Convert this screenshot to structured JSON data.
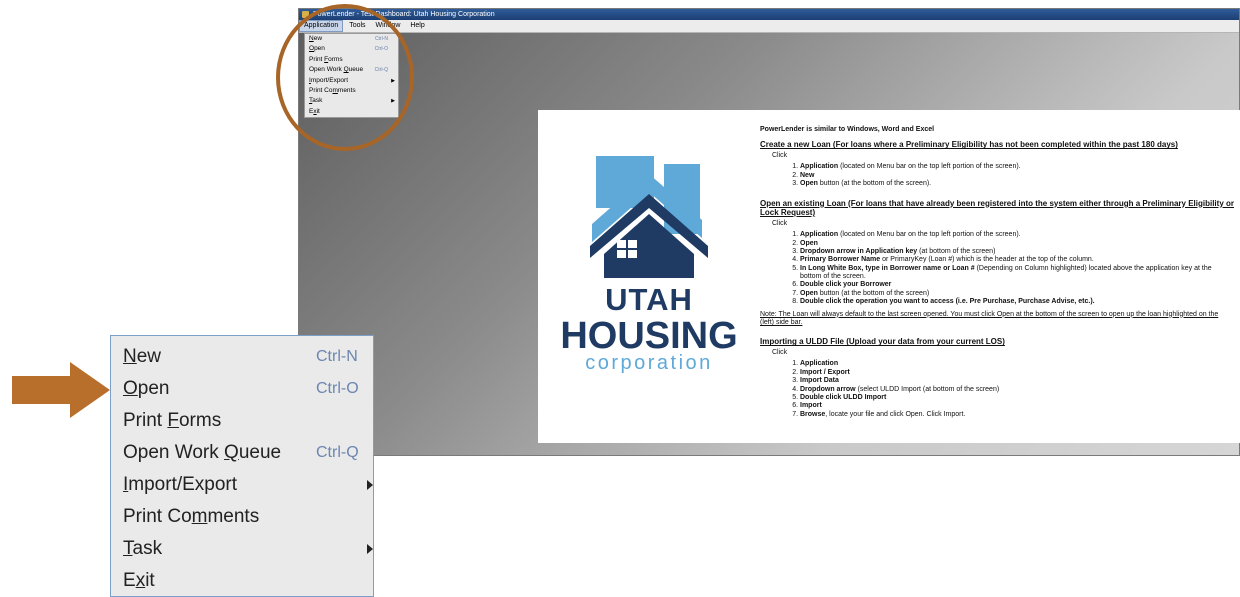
{
  "window": {
    "title": "PowerLender - Test Dashboard: Utah Housing Corporation",
    "menu_bar": [
      {
        "label": "Application",
        "active": true
      },
      {
        "label": "Tools"
      },
      {
        "label": "Window"
      },
      {
        "label": "Help"
      }
    ]
  },
  "menu": {
    "items": [
      {
        "pre": "",
        "u": "N",
        "post": "ew",
        "shortcut": "Ctrl-N",
        "submenu": false
      },
      {
        "pre": "",
        "u": "O",
        "post": "pen",
        "shortcut": "Ctrl-O",
        "submenu": false
      },
      {
        "pre": "Print ",
        "u": "F",
        "post": "orms",
        "shortcut": "",
        "submenu": false
      },
      {
        "pre": "Open Work ",
        "u": "Q",
        "post": "ueue",
        "shortcut": "Ctrl-Q",
        "submenu": false
      },
      {
        "pre": "",
        "u": "I",
        "post": "mport/Export",
        "shortcut": "",
        "submenu": true
      },
      {
        "pre": "Print Co",
        "u": "m",
        "post": "ments",
        "shortcut": "",
        "submenu": false
      },
      {
        "pre": "",
        "u": "T",
        "post": "ask",
        "shortcut": "",
        "submenu": true
      },
      {
        "pre": "E",
        "u": "x",
        "post": "it",
        "shortcut": "",
        "submenu": false
      }
    ]
  },
  "logo": {
    "line1": "UTAH",
    "line2": "HOUSING",
    "line3": "corporation"
  },
  "doc": {
    "intro": "PowerLender is similar to Windows, Word and Excel",
    "click_label": "Click",
    "sections": [
      {
        "heading": "Create a new Loan (For loans where a Preliminary Eligibility has not been completed within the past 180 days)",
        "steps": [
          {
            "bold": "Application",
            "rest": " (located on Menu bar on the top left portion of the screen)."
          },
          {
            "bold": "New",
            "rest": ""
          },
          {
            "bold": "Open",
            "rest": " button (at the bottom of the screen)."
          }
        ]
      },
      {
        "heading": "Open an existing Loan (For loans that have already been registered into the system either through a Preliminary Eligibility or Lock Request)",
        "steps": [
          {
            "bold": "Application",
            "rest": " (located on Menu bar on the top left portion of the screen)."
          },
          {
            "bold": "Open",
            "rest": ""
          },
          {
            "bold": "Dropdown arrow in Application key",
            "rest": " (at bottom of the screen)"
          },
          {
            "bold": "Primary Borrower Name",
            "rest": " or PrimaryKey (Loan #) which is the header at the top of the column."
          },
          {
            "bold": "In Long White Box, type in Borrower name or Loan #",
            "rest": " (Depending on Column highlighted) located above the application key at the bottom of the screen."
          },
          {
            "bold": "Double click your Borrower",
            "rest": ""
          },
          {
            "bold": "Open",
            "rest": " button (at the bottom of the screen)"
          },
          {
            "bold": "Double click the operation you want to access (i.e. Pre Purchase, Purchase Advise, etc.).",
            "rest": ""
          }
        ],
        "note": "Note: The Loan will always default to the last screen opened. You must click Open at the bottom of the screen to open up the loan highlighted on the (left) side bar."
      },
      {
        "heading": "Importing a ULDD File (Upload your data from your current LOS)",
        "steps": [
          {
            "bold": "Application",
            "rest": ""
          },
          {
            "bold": "Import / Export",
            "rest": ""
          },
          {
            "bold": "Import Data",
            "rest": ""
          },
          {
            "bold": "Dropdown arrow",
            "rest": " (select ULDD Import (at bottom of the screen)"
          },
          {
            "bold": "Double click ULDD Import",
            "rest": ""
          },
          {
            "bold": "Import",
            "rest": ""
          },
          {
            "bold": "Browse",
            "rest": ", locate your file and click Open.  Click Import."
          }
        ]
      }
    ]
  },
  "colors": {
    "accent_ring": "#a86528",
    "arrow": "#b86f2c",
    "logo_navy": "#1f3b63",
    "logo_blue": "#5ea9d8"
  },
  "icons": {
    "arrow": "right-arrow-icon",
    "submenu": "submenu-arrow-icon"
  }
}
